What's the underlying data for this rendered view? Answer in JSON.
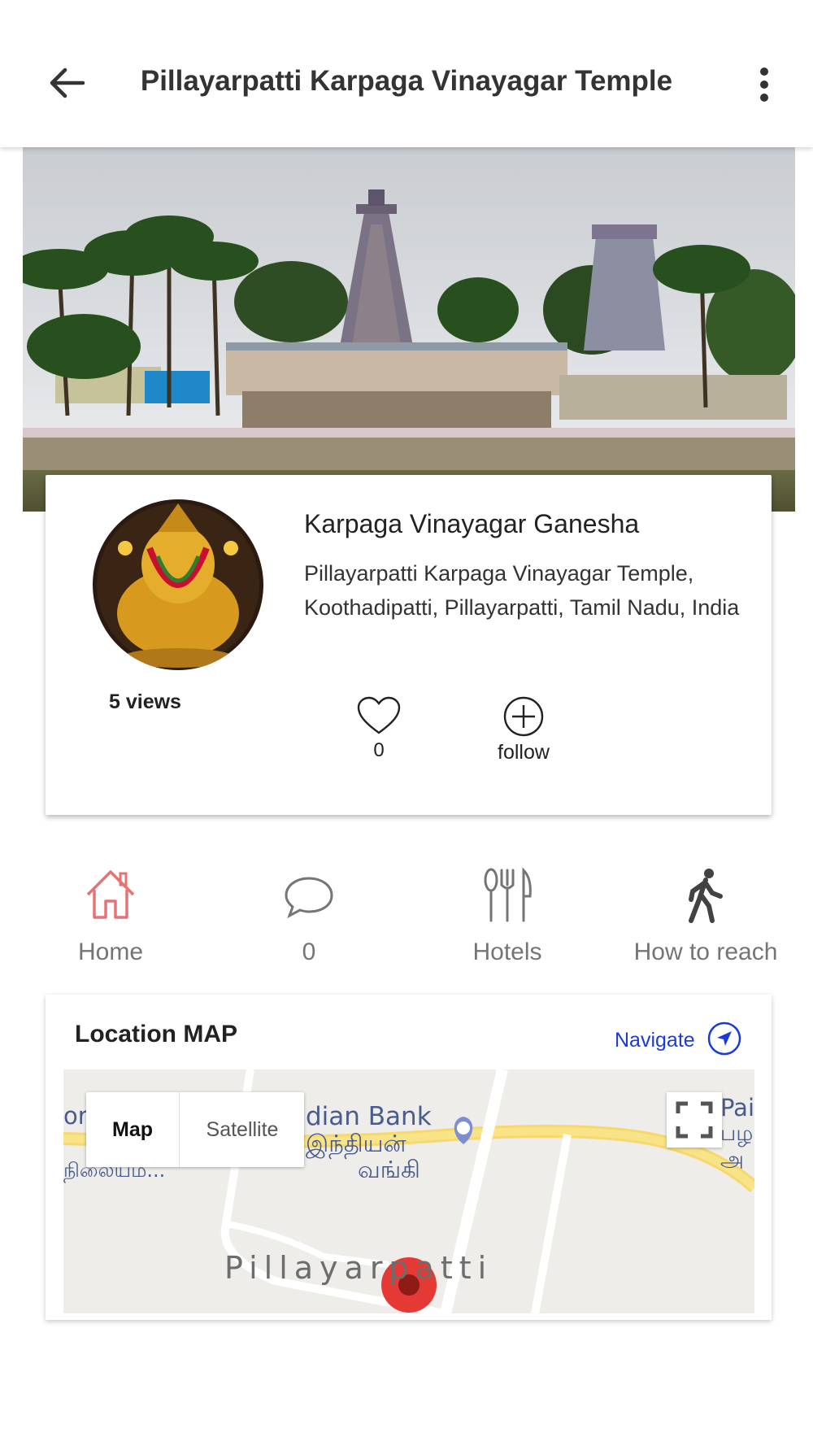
{
  "appbar": {
    "title": "Pillayarpatti Karpaga Vinayagar Temple",
    "back_icon": "arrow-left-icon",
    "menu_icon": "more-vertical-icon"
  },
  "profile": {
    "name": "Karpaga Vinayagar Ganesha",
    "address": "Pillayarpatti Karpaga Vinayagar Temple, Koothadipatti, Pillayarpatti, Tamil Nadu, India",
    "views": "5 views",
    "likes": "0",
    "follow_label": "follow"
  },
  "tabs": [
    {
      "label": "Home",
      "icon": "home-icon",
      "color": "#e53935"
    },
    {
      "label": "0",
      "icon": "comment-icon",
      "color": "#757575"
    },
    {
      "label": "Hotels",
      "icon": "fork-knife-icon",
      "color": "#757575"
    },
    {
      "label": "How to reach",
      "icon": "walking-icon",
      "color": "#424242"
    }
  ],
  "location": {
    "title": "Location MAP",
    "navigate_label": "Navigate",
    "accent": "#1a3bd8",
    "map": {
      "toggle_map": "Map",
      "toggle_satellite": "Satellite",
      "labels": {
        "bank_en": "dian Bank",
        "bank_ta_1": "இந்தியன்",
        "bank_ta_2": "வங்கி",
        "left_top": "or",
        "left_bottom": "நிலையம்...",
        "right_top": "Pai",
        "right_mid": "பழ",
        "right_bottom": "அ",
        "town": "Pillayarpatti"
      }
    }
  }
}
